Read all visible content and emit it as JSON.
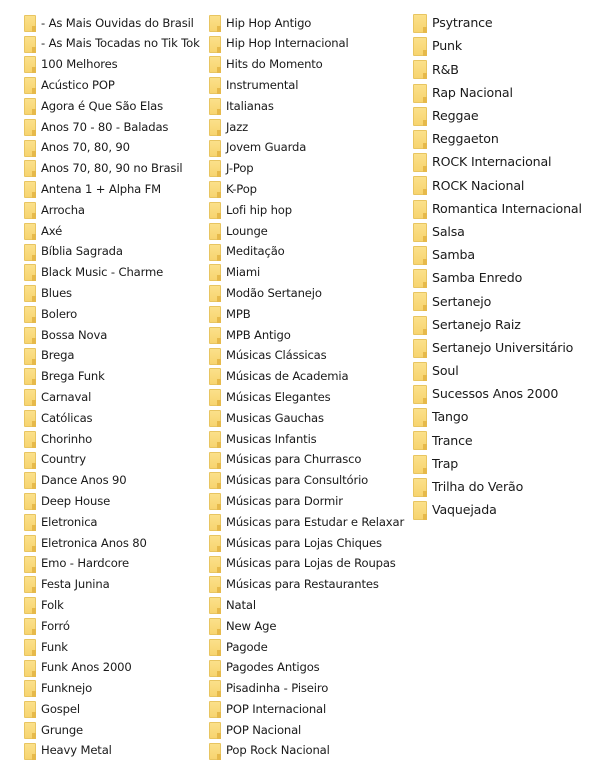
{
  "folder_list": {
    "icon": "folder-icon",
    "icon_color": "#f7d46f",
    "columns": [
      {
        "items": [
          {
            "label": "- As Mais Ouvidas do Brasil"
          },
          {
            "label": "- As Mais Tocadas no Tik Tok"
          },
          {
            "label": "100 Melhores"
          },
          {
            "label": "Acústico POP"
          },
          {
            "label": "Agora é Que São Elas"
          },
          {
            "label": "Anos 70 - 80 - Baladas"
          },
          {
            "label": "Anos 70, 80, 90"
          },
          {
            "label": "Anos 70, 80, 90 no Brasil"
          },
          {
            "label": "Antena 1 + Alpha FM"
          },
          {
            "label": "Arrocha"
          },
          {
            "label": "Axé"
          },
          {
            "label": "Bíblia Sagrada"
          },
          {
            "label": "Black Music - Charme"
          },
          {
            "label": "Blues"
          },
          {
            "label": "Bolero"
          },
          {
            "label": "Bossa Nova"
          },
          {
            "label": "Brega"
          },
          {
            "label": "Brega Funk"
          },
          {
            "label": "Carnaval"
          },
          {
            "label": "Católicas"
          },
          {
            "label": "Chorinho"
          },
          {
            "label": "Country"
          },
          {
            "label": "Dance Anos 90"
          },
          {
            "label": "Deep House"
          },
          {
            "label": "Eletronica"
          },
          {
            "label": "Eletronica Anos 80"
          },
          {
            "label": "Emo - Hardcore"
          },
          {
            "label": "Festa Junina"
          },
          {
            "label": "Folk"
          },
          {
            "label": "Forró"
          },
          {
            "label": "Funk"
          },
          {
            "label": "Funk Anos 2000"
          },
          {
            "label": "Funknejo"
          },
          {
            "label": "Gospel"
          },
          {
            "label": "Grunge"
          },
          {
            "label": "Heavy Metal"
          }
        ]
      },
      {
        "items": [
          {
            "label": "Hip Hop Antigo"
          },
          {
            "label": "Hip Hop Internacional"
          },
          {
            "label": "Hits do Momento"
          },
          {
            "label": "Instrumental"
          },
          {
            "label": "Italianas"
          },
          {
            "label": "Jazz"
          },
          {
            "label": "Jovem Guarda"
          },
          {
            "label": "J-Pop"
          },
          {
            "label": "K-Pop"
          },
          {
            "label": "Lofi hip hop"
          },
          {
            "label": "Lounge"
          },
          {
            "label": "Meditação"
          },
          {
            "label": "Miami"
          },
          {
            "label": "Modão Sertanejo"
          },
          {
            "label": "MPB"
          },
          {
            "label": "MPB Antigo"
          },
          {
            "label": "Músicas Clássicas"
          },
          {
            "label": "Músicas de Academia"
          },
          {
            "label": "Músicas Elegantes"
          },
          {
            "label": "Musicas Gauchas"
          },
          {
            "label": "Musicas Infantis"
          },
          {
            "label": "Músicas para Churrasco"
          },
          {
            "label": "Músicas para Consultório"
          },
          {
            "label": "Músicas para Dormir"
          },
          {
            "label": "Músicas para Estudar e Relaxar"
          },
          {
            "label": "Músicas para Lojas Chiques"
          },
          {
            "label": "Músicas para Lojas de Roupas"
          },
          {
            "label": "Músicas para Restaurantes"
          },
          {
            "label": "Natal"
          },
          {
            "label": "New Age"
          },
          {
            "label": "Pagode"
          },
          {
            "label": "Pagodes Antigos"
          },
          {
            "label": "Pisadinha - Piseiro"
          },
          {
            "label": "POP Internacional"
          },
          {
            "label": "POP Nacional"
          },
          {
            "label": "Pop Rock Nacional"
          }
        ]
      },
      {
        "items": [
          {
            "label": "Psytrance"
          },
          {
            "label": "Punk"
          },
          {
            "label": "R&B"
          },
          {
            "label": "Rap Nacional"
          },
          {
            "label": "Reggae"
          },
          {
            "label": "Reggaeton"
          },
          {
            "label": "ROCK Internacional"
          },
          {
            "label": "ROCK Nacional"
          },
          {
            "label": "Romantica Internacional"
          },
          {
            "label": "Salsa"
          },
          {
            "label": "Samba"
          },
          {
            "label": "Samba Enredo"
          },
          {
            "label": "Sertanejo"
          },
          {
            "label": "Sertanejo Raiz"
          },
          {
            "label": "Sertanejo Universitário"
          },
          {
            "label": "Soul"
          },
          {
            "label": "Sucessos Anos 2000"
          },
          {
            "label": "Tango"
          },
          {
            "label": "Trance"
          },
          {
            "label": "Trap"
          },
          {
            "label": "Trilha do Verão"
          },
          {
            "label": "Vaquejada"
          }
        ]
      }
    ]
  }
}
